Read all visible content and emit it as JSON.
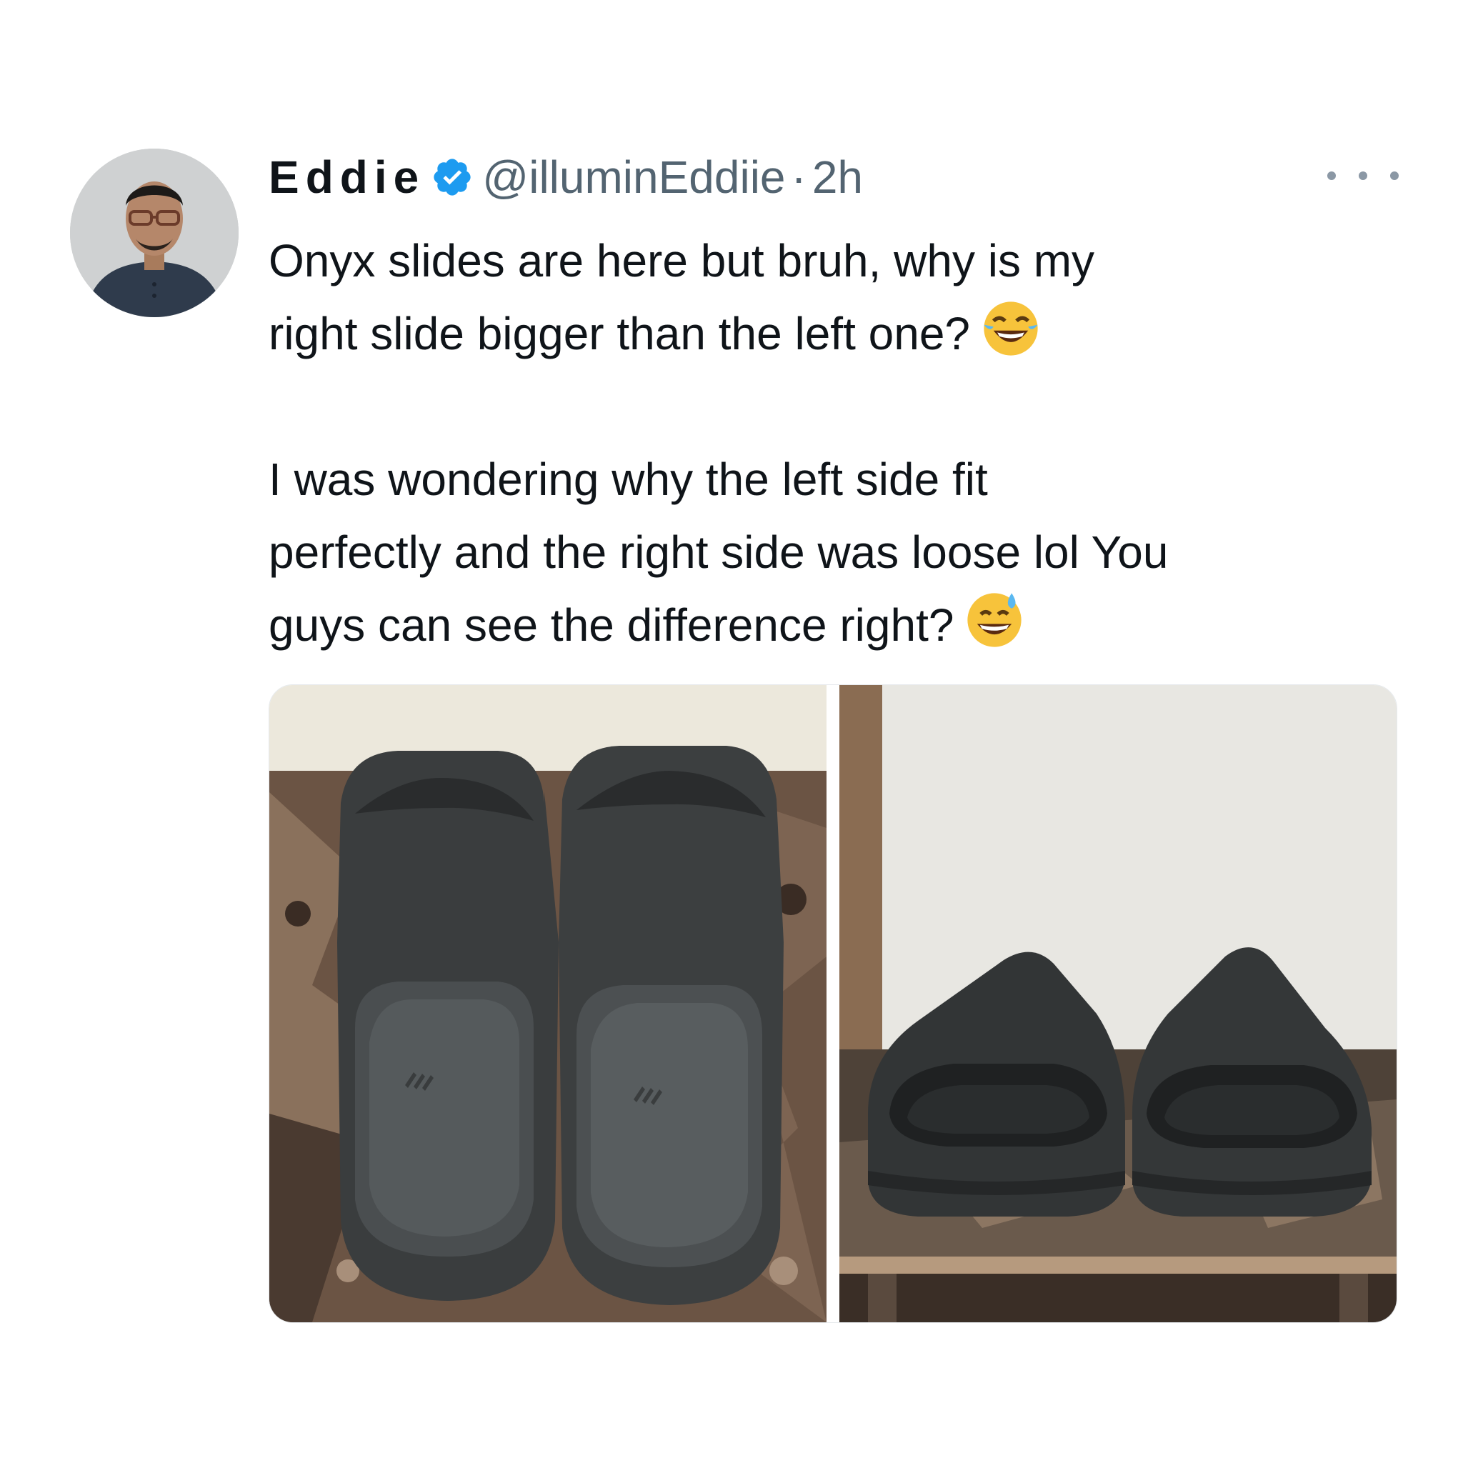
{
  "tweet": {
    "author_name": "Eddie",
    "handle": "@illuminEddiie",
    "separator": "·",
    "timestamp": "2h",
    "text_paragraph_1": "Onyx slides are here but bruh, why is my\nright slide bigger than the left one?",
    "text_paragraph_2": "I was wondering why the left side fit\nperfectly and the right side was loose lol You\nguys can see the difference right?",
    "emoji_1": "face-with-tears-of-joy",
    "emoji_2": "grinning-face-with-sweat",
    "verified": true
  },
  "media": {
    "photo_count": 2
  },
  "colors": {
    "verified_blue": "#1d9bf0",
    "secondary_text": "#536471",
    "primary_text": "#0f1419",
    "slide_color": "#3a3d3e"
  }
}
